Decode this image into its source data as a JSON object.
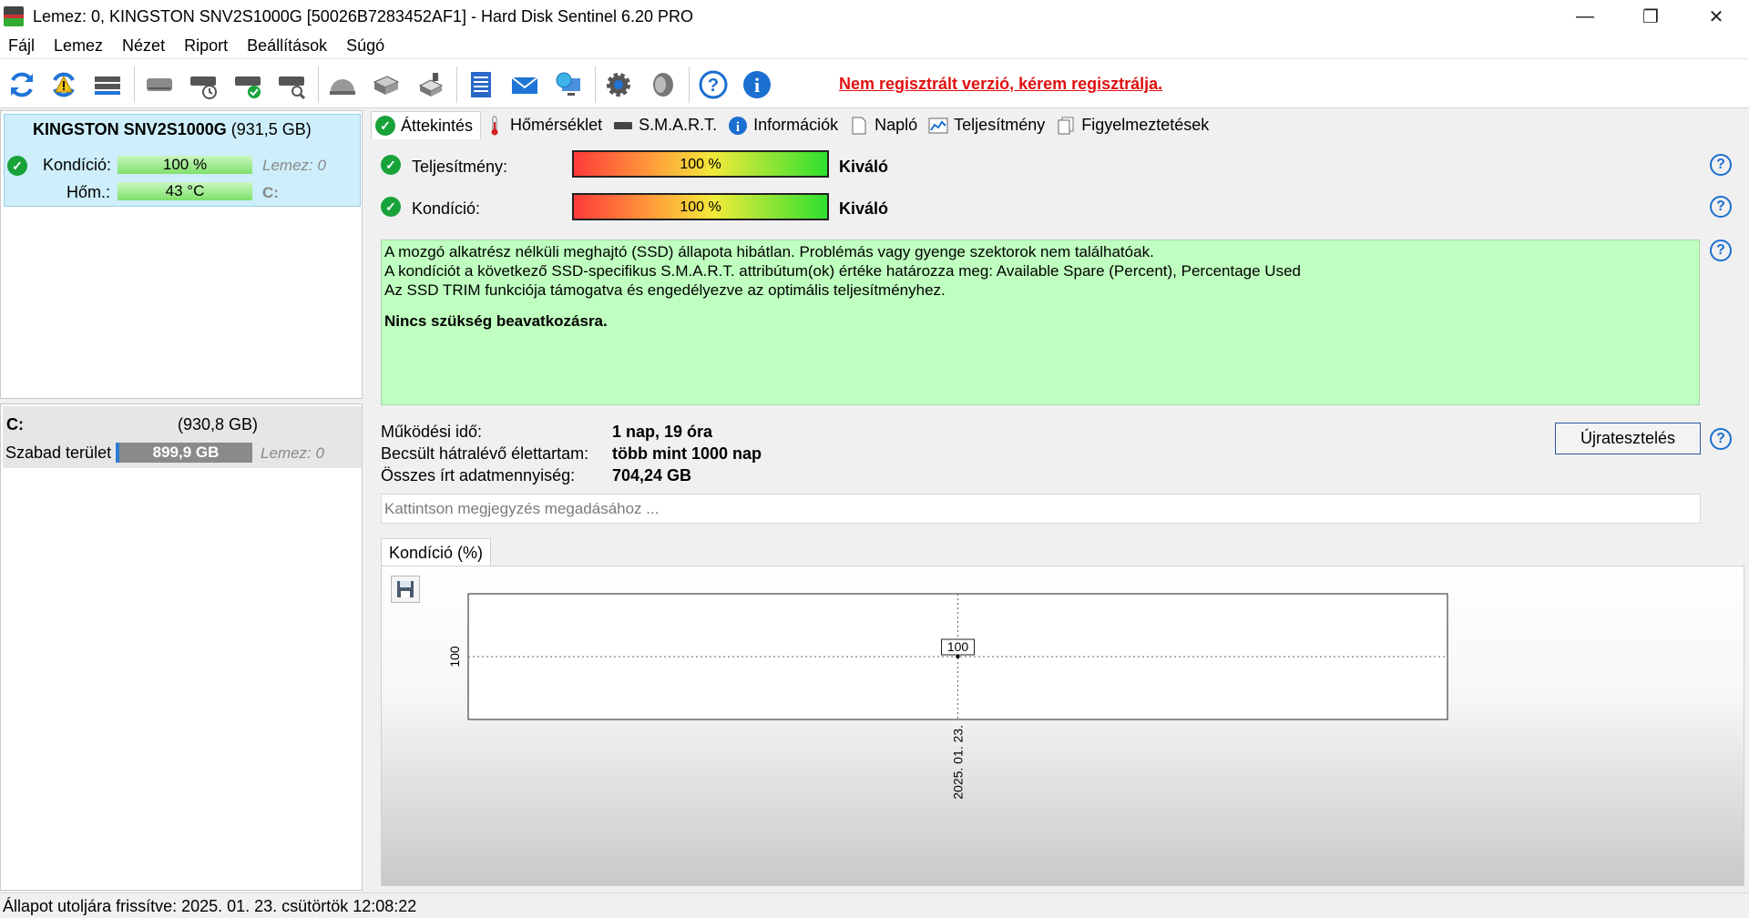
{
  "window": {
    "title": "Lemez: 0, KINGSTON SNV2S1000G [50026B7283452AF1]  -  Hard Disk Sentinel 6.20 PRO",
    "controls": {
      "minimize": "—",
      "maximize": "❐",
      "close": "✕"
    }
  },
  "menu": [
    "Fájl",
    "Lemez",
    "Nézet",
    "Riport",
    "Beállítások",
    "Súgó"
  ],
  "toolbar": {
    "register_notice": "Nem regisztrált verzió, kérem regisztrálja.",
    "icons": [
      "refresh-icon",
      "refresh-warning-icon",
      "disk-list-icon",
      "disk-gray-icon",
      "disk-clock-icon",
      "disk-check-icon",
      "disk-search-icon",
      "disk-dome-icon",
      "disk-stack-icon",
      "disk-usb-icon",
      "report-notepad-icon",
      "email-icon",
      "network-globe-icon",
      "settings-gear-icon",
      "sound-icon",
      "help-icon",
      "info-icon"
    ]
  },
  "disk": {
    "name": "KINGSTON SNV2S1000G",
    "size": "(931,5 GB)",
    "condition_label": "Kondíció:",
    "condition_value": "100 %",
    "condition_fraction": 1.0,
    "disk_label": "Lemez: 0",
    "temp_label": "Hőm.:",
    "temp_value": "43 °C",
    "drive_letter": "C:"
  },
  "volume": {
    "letter": "C:",
    "size": "(930,8 GB)",
    "free_label": "Szabad terület",
    "free_value": "899,9 GB",
    "disk_label": "Lemez: 0"
  },
  "tabs": [
    {
      "label": "Áttekintés",
      "icon": "check-icon",
      "active": true
    },
    {
      "label": "Hőmérséklet",
      "icon": "thermometer-icon",
      "active": false
    },
    {
      "label": "S.M.A.R.T.",
      "icon": "smart-disk-icon",
      "active": false
    },
    {
      "label": "Információk",
      "icon": "info-icon",
      "active": false
    },
    {
      "label": "Napló",
      "icon": "log-page-icon",
      "active": false
    },
    {
      "label": "Teljesítmény",
      "icon": "performance-chart-icon",
      "active": false
    },
    {
      "label": "Figyelmeztetések",
      "icon": "warnings-pages-icon",
      "active": false
    }
  ],
  "overview": {
    "performance": {
      "label": "Teljesítmény:",
      "value": "100 %",
      "fraction": 1.0,
      "rating": "Kiváló"
    },
    "health": {
      "label": "Kondíció:",
      "value": "100 %",
      "fraction": 1.0,
      "rating": "Kiváló"
    },
    "status_lines": [
      "A mozgó alkatrész nélküli meghajtó (SSD) állapota hibátlan. Problémás vagy gyenge szektorok nem találhatóak.",
      "A kondíciót a következő SSD-specifikus S.M.A.R.T. attribútum(ok) értéke határozza meg:  Available Spare (Percent), Percentage Used",
      "Az SSD TRIM funkciója támogatva és engedélyezve az optimális teljesítményhez."
    ],
    "status_action": "Nincs szükség beavatkozásra.",
    "uptime_label": "Működési idő:",
    "uptime_value": "1 nap, 19 óra",
    "lifetime_label": "Becsült hátralévő élettartam:",
    "lifetime_value": "több mint 1000 nap",
    "written_label": "Összes írt adatmennyiség:",
    "written_value": "704,24 GB",
    "retest_label": "Újratesztelés",
    "note_placeholder": "Kattintson megjegyzés megadásához ...",
    "chart_tab": "Kondíció  (%)",
    "status_color": "#bfffbf"
  },
  "chart_data": {
    "type": "line",
    "x": [
      "2025. 01. 23."
    ],
    "series": [
      {
        "values": [
          100
        ]
      }
    ],
    "ylabel": "",
    "xlabel": "",
    "ytick_labels": [
      "100"
    ],
    "xtick_labels": [
      "2025. 01. 23."
    ],
    "data_labels": [
      "100"
    ],
    "grid": true
  },
  "statusbar": {
    "text": "Állapot utoljára frissítve: 2025. 01. 23. csütörtök 12:08:22"
  }
}
